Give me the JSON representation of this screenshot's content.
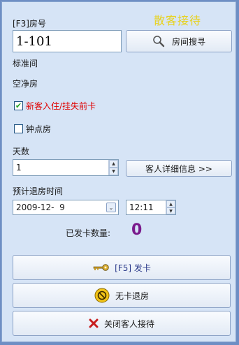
{
  "window": {
    "title": "散客接待"
  },
  "room": {
    "label": "[F3]房号",
    "value": "1-101",
    "search_button": "房间搜寻",
    "type": "标准间",
    "status": "空净房"
  },
  "options": {
    "new_guest": {
      "label": "新客入住/挂失前卡",
      "checked": true,
      "color": "#e00000"
    },
    "hourly_room": {
      "label": "钟点房",
      "checked": false
    }
  },
  "stay": {
    "days_label": "天数",
    "days_value": "1",
    "details_button": "客人详细信息 >>",
    "checkout_label": "预计退房时间",
    "checkout_date": "2009-12-  9",
    "checkout_time": "12:11"
  },
  "cards": {
    "issued_label": "已发卡数量:",
    "issued_count": "0"
  },
  "actions": {
    "issue_card": "[F5] 发卡",
    "checkout_no_card": "无卡退房",
    "close": "关闭客人接待"
  },
  "colors": {
    "title": "#e8d21e",
    "warning_text": "#e00000",
    "count": "#7a1a8c",
    "panel_bg": "#d6e4f6"
  }
}
